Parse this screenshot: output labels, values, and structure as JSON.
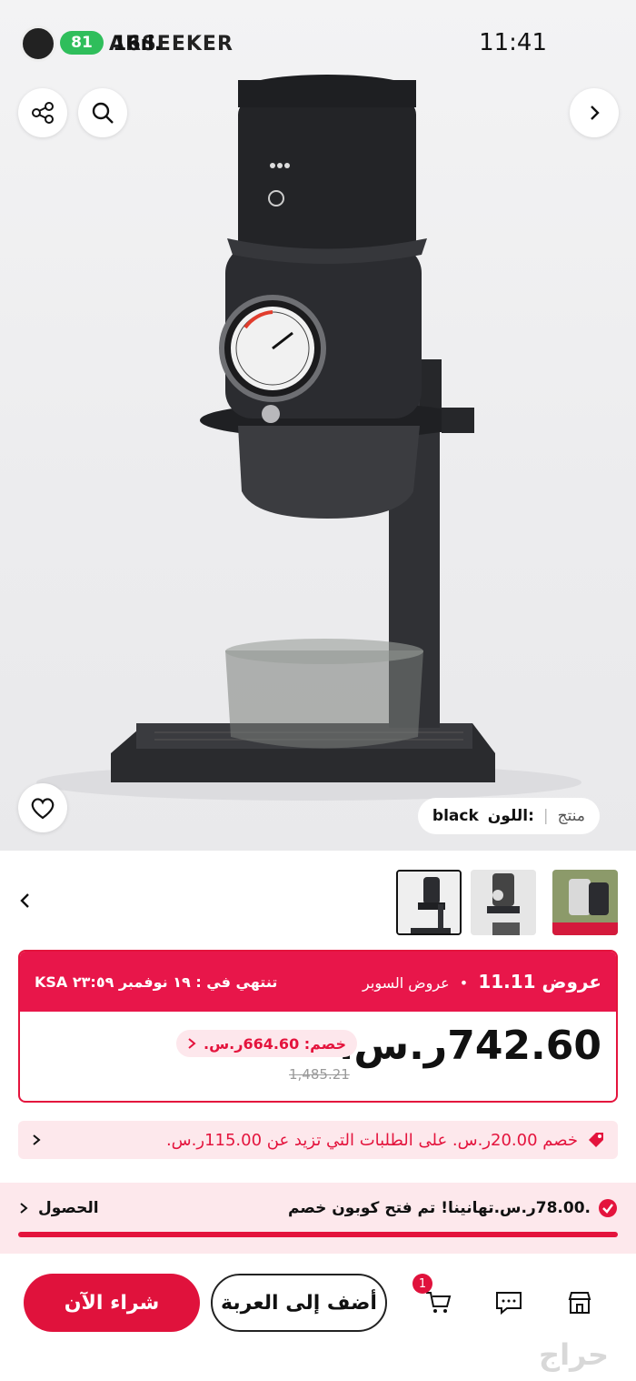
{
  "status_bar": {
    "time": "11:41",
    "battery": "81",
    "brand_text": "ARSEEKER",
    "signal": "16",
    "signal_suffix": "ıl."
  },
  "hero": {
    "product_label": "منتج",
    "separator": "|",
    "color_label": "اللون:",
    "color_value": "black"
  },
  "deal": {
    "title": "عروض 11.11",
    "subtitle": "عروض السوبر",
    "ends": "تنتهي في : ١٩ نوفمبر ٢٣:٥٩ KSA",
    "price": "742.60ر.س.",
    "discount": "خصم: 664.60ر.س.",
    "old_price": "1,485.21"
  },
  "promo": {
    "text": "خصم 20.00ر.س. على الطلبات التي تزيد عن 115.00ر.س."
  },
  "coupon": {
    "text": ".78.00ر.س.تهانينا! تم فتح كوبون خصم",
    "action": "الحصول"
  },
  "bottom_bar": {
    "buy_now": "شراء الآن",
    "add_to_cart": "أضف إلى العربة",
    "cart_count": "1",
    "watermark": "حراج"
  },
  "colors": {
    "accent": "#e0123c",
    "accent_light": "#fde8ec"
  }
}
